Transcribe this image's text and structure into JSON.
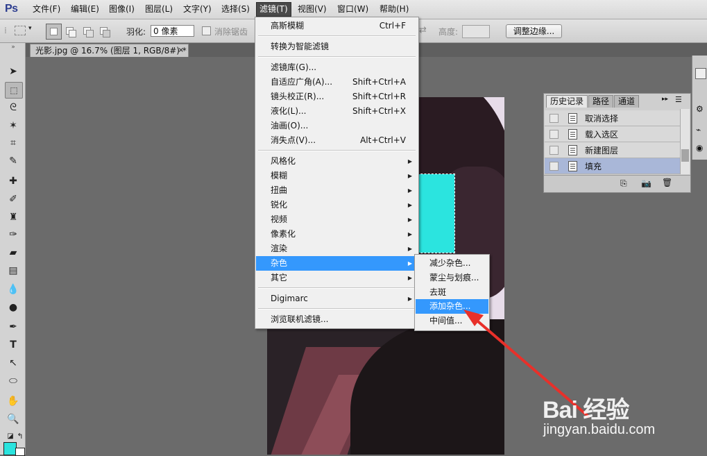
{
  "app": {
    "logo": "Ps"
  },
  "menubar": {
    "items": [
      {
        "label": "文件(F)"
      },
      {
        "label": "编辑(E)"
      },
      {
        "label": "图像(I)"
      },
      {
        "label": "图层(L)"
      },
      {
        "label": "文字(Y)"
      },
      {
        "label": "选择(S)"
      },
      {
        "label": "滤镜(T)"
      },
      {
        "label": "视图(V)"
      },
      {
        "label": "窗口(W)"
      },
      {
        "label": "帮助(H)"
      }
    ],
    "active_index": 6
  },
  "options": {
    "feather_label": "羽化:",
    "feather_value": "0 像素",
    "antialias_label": "消除锯齿",
    "height_label": "高度:",
    "refine_edge_label": "调整边缘..."
  },
  "document": {
    "tab_title": "光影.jpg @ 16.7% (图层 1, RGB/8#) *",
    "close": "×"
  },
  "filter_menu": {
    "items": [
      {
        "label": "高斯模糊",
        "shortcut": "Ctrl+F"
      },
      {
        "label": "转换为智能滤镜"
      },
      {
        "label": "滤镜库(G)..."
      },
      {
        "label": "自适应广角(A)...",
        "shortcut": "Shift+Ctrl+A"
      },
      {
        "label": "镜头校正(R)...",
        "shortcut": "Shift+Ctrl+R"
      },
      {
        "label": "液化(L)...",
        "shortcut": "Shift+Ctrl+X"
      },
      {
        "label": "油画(O)..."
      },
      {
        "label": "消失点(V)...",
        "shortcut": "Alt+Ctrl+V"
      },
      {
        "label": "风格化"
      },
      {
        "label": "模糊"
      },
      {
        "label": "扭曲"
      },
      {
        "label": "锐化"
      },
      {
        "label": "视频"
      },
      {
        "label": "像素化"
      },
      {
        "label": "渲染"
      },
      {
        "label": "杂色"
      },
      {
        "label": "其它"
      },
      {
        "label": "Digimarc"
      },
      {
        "label": "浏览联机滤镜..."
      }
    ]
  },
  "noise_submenu": {
    "items": [
      {
        "label": "减少杂色..."
      },
      {
        "label": "蒙尘与划痕..."
      },
      {
        "label": "去斑"
      },
      {
        "label": "添加杂色..."
      },
      {
        "label": "中间值..."
      }
    ],
    "highlighted_index": 3
  },
  "history_panel": {
    "tabs": [
      {
        "label": "历史记录"
      },
      {
        "label": "路径"
      },
      {
        "label": "通道"
      }
    ],
    "states": [
      {
        "label": "取消选择"
      },
      {
        "label": "载入选区"
      },
      {
        "label": "新建图层"
      },
      {
        "label": "填充"
      }
    ]
  },
  "colors": {
    "foreground": "#2ae3de",
    "background": "#ffffff",
    "menu_highlight": "#3498fd",
    "arrow": "#e8302a"
  },
  "watermark": {
    "logo": "Bai 经验",
    "url": "jingyan.baidu.com"
  }
}
